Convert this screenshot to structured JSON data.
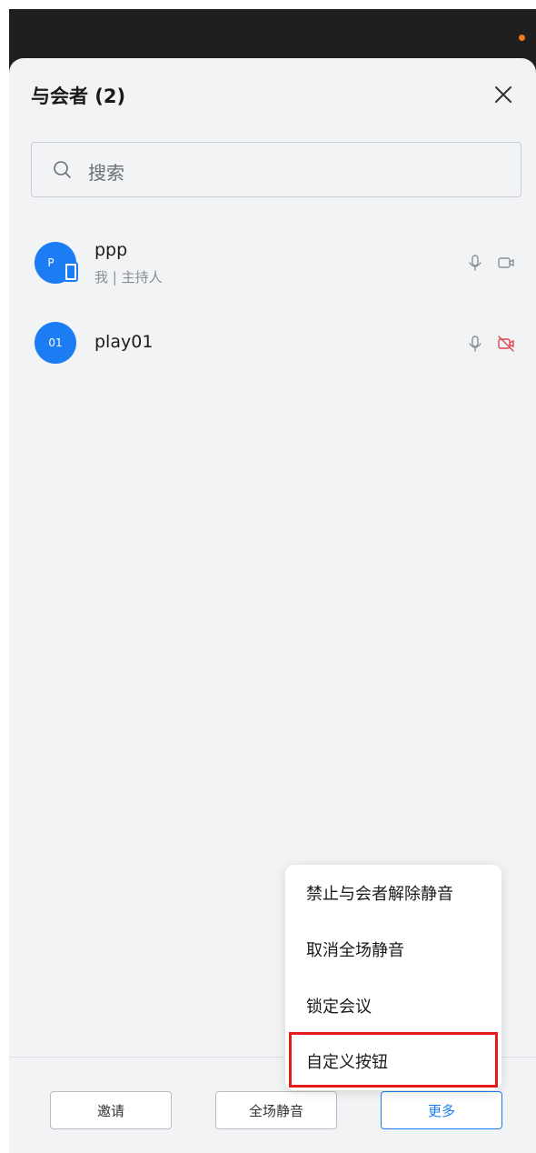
{
  "header": {
    "title": "与会者 (2)"
  },
  "search": {
    "placeholder": "搜索"
  },
  "participants": [
    {
      "avatar_text": "P",
      "name": "ppp",
      "subtitle": "我 | 主持人",
      "mic": "on",
      "camera": "on"
    },
    {
      "avatar_text": "01",
      "name": "play01",
      "subtitle": "",
      "mic": "on",
      "camera": "off"
    }
  ],
  "more_menu": {
    "items": [
      {
        "label": "禁止与会者解除静音"
      },
      {
        "label": "取消全场静音"
      },
      {
        "label": "锁定会议"
      },
      {
        "label": "自定义按钮",
        "highlighted": true
      }
    ]
  },
  "footer": {
    "invite_label": "邀请",
    "mute_all_label": "全场静音",
    "more_label": "更多"
  },
  "colors": {
    "accent": "#1c7cf4",
    "camera_off": "#e0454e",
    "highlight_border": "#e31b1b",
    "status_dot": "#f0781e"
  }
}
